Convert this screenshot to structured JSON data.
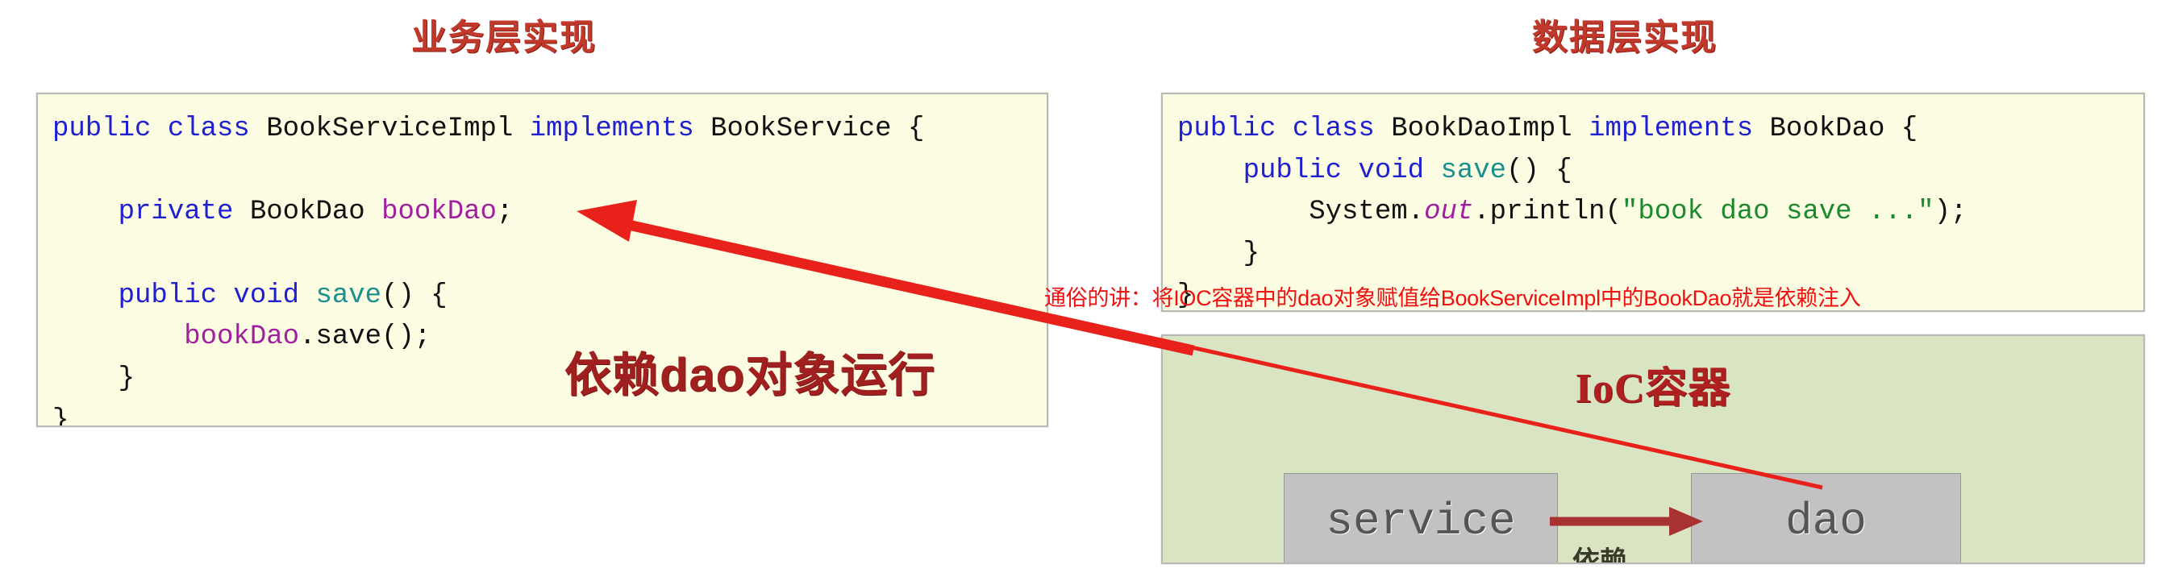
{
  "headings": {
    "left": "业务层实现",
    "right": "数据层实现"
  },
  "code_left": {
    "lines": [
      [
        {
          "t": "public class ",
          "c": "kw"
        },
        {
          "t": "BookServiceImpl ",
          "c": "pln"
        },
        {
          "t": "implements ",
          "c": "kw"
        },
        {
          "t": "BookService {",
          "c": "pln"
        }
      ],
      [],
      [
        {
          "t": "    private ",
          "c": "kw"
        },
        {
          "t": "BookDao ",
          "c": "pln"
        },
        {
          "t": "bookDao",
          "c": "fld"
        },
        {
          "t": ";",
          "c": "pln"
        }
      ],
      [],
      [
        {
          "t": "    public void ",
          "c": "kw"
        },
        {
          "t": "save",
          "c": "mth"
        },
        {
          "t": "() {",
          "c": "pln"
        }
      ],
      [
        {
          "t": "        bookDao",
          "c": "fld"
        },
        {
          "t": ".save();",
          "c": "pln"
        }
      ],
      [
        {
          "t": "    }",
          "c": "pln"
        }
      ],
      [
        {
          "t": "}",
          "c": "pln"
        }
      ]
    ],
    "overlay_label": "依赖dao对象运行"
  },
  "code_right": {
    "lines": [
      [
        {
          "t": "public class ",
          "c": "kw"
        },
        {
          "t": "BookDaoImpl ",
          "c": "pln"
        },
        {
          "t": "implements ",
          "c": "kw"
        },
        {
          "t": "BookDao {",
          "c": "pln"
        }
      ],
      [
        {
          "t": "    public void ",
          "c": "kw"
        },
        {
          "t": "save",
          "c": "mth"
        },
        {
          "t": "() {",
          "c": "pln"
        }
      ],
      [
        {
          "t": "        System.",
          "c": "pln"
        },
        {
          "t": "out",
          "c": "stat"
        },
        {
          "t": ".println(",
          "c": "pln"
        },
        {
          "t": "\"book dao save ...\"",
          "c": "str"
        },
        {
          "t": ");",
          "c": "pln"
        }
      ],
      [
        {
          "t": "    }",
          "c": "pln"
        }
      ],
      [
        {
          "t": "}",
          "c": "pln"
        }
      ]
    ]
  },
  "annotation": {
    "note": "通俗的讲：将IOC容器中的dao对象赋值给BookServiceImpl中的BookDao就是依赖注入"
  },
  "ioc": {
    "title": "IoC容器",
    "beans": [
      {
        "label": "service"
      },
      {
        "label": "dao"
      }
    ],
    "arrow_label": "依赖"
  },
  "colors": {
    "heading_red": "#c0392b",
    "note_red": "#f01010",
    "arrow_red": "#e8211b",
    "code_bg": "#fcfce2",
    "ioc_bg": "#d9e4c3",
    "bean_bg": "#c2c2c2",
    "dep_arrow": "#a83232",
    "keyword_blue": "#2020d0",
    "method_teal": "#1a8f8f",
    "field_purple": "#a020a0",
    "string_green": "#1b8a2c"
  }
}
